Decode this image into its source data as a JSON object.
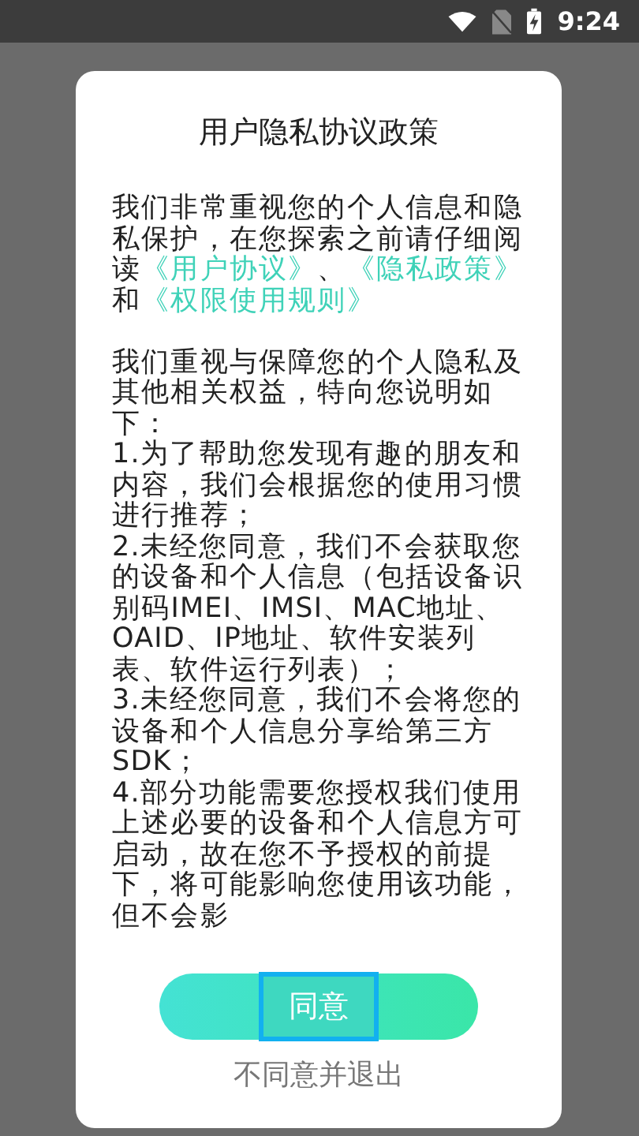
{
  "status_bar": {
    "time": "9:24"
  },
  "dialog": {
    "title": "用户隐私协议政策",
    "intro": [
      {
        "kind": "text",
        "text": "我们非常重视您的个人信息和隐私保护，在您探索之前请仔细阅读"
      },
      {
        "kind": "link",
        "text": "《用户协议》"
      },
      {
        "kind": "text",
        "text": "、"
      },
      {
        "kind": "link",
        "text": "《隐私政策》"
      },
      {
        "kind": "text",
        "text": "和"
      },
      {
        "kind": "link",
        "text": "《权限使用规则》"
      }
    ],
    "paragraphs": [
      "我们重视与保障您的个人隐私及其他相关权益，特向您说明如下：",
      "1.为了帮助您发现有趣的朋友和内容，我们会根据您的使用习惯进行推荐；",
      "2.未经您同意，我们不会获取您的设备和个人信息（包括设备识别码IMEI、IMSI、MAC地址、OAID、IP地址、软件安装列表、软件运行列表）；",
      "3.未经您同意，我们不会将您的设备和个人信息分享给第三方SDK；",
      "4.部分功能需要您授权我们使用上述必要的设备和个人信息方可启动，故在您不予授权的前提下，将可能影响您使用该功能，但不会影"
    ],
    "agree_button": {
      "label": "同意",
      "focused": true
    },
    "decline_link": "不同意并退出"
  }
}
